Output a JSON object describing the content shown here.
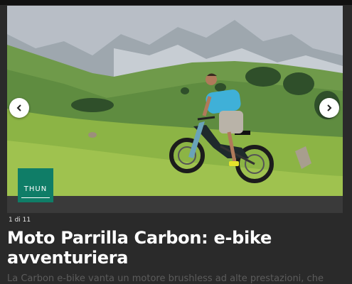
{
  "slide": {
    "counter": "1 di 11",
    "title": "Moto Parrilla Carbon: e-bike avventuriera",
    "subtitle": "La Carbon e-bike vanta un motore brushless ad alte prestazioni, che"
  },
  "logo": {
    "text": "THUN",
    "color": "#0f7d67"
  },
  "controls": {
    "prev_icon": "chevron-left-icon",
    "next_icon": "chevron-right-icon"
  },
  "colors": {
    "background": "#2a2a2a",
    "title": "#ffffff",
    "subtitle": "#5c5c5c"
  }
}
